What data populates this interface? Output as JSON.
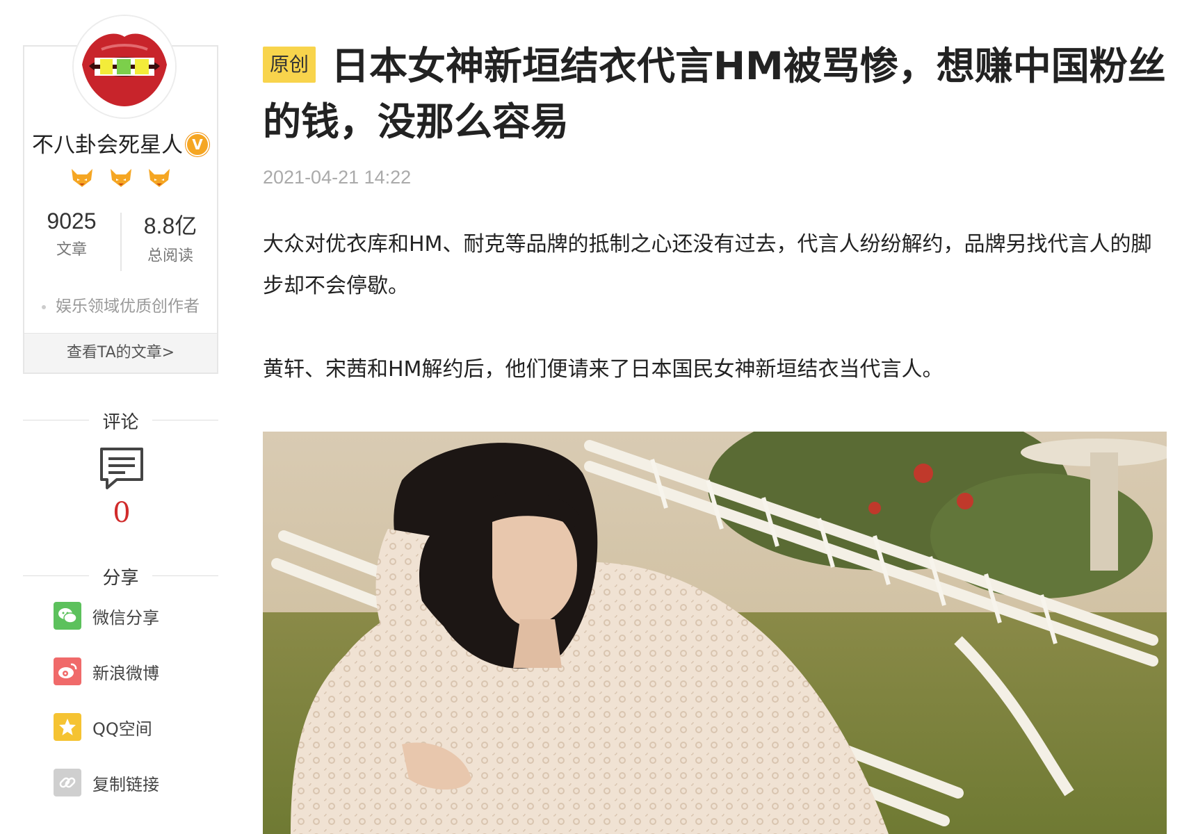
{
  "author": {
    "name": "不八卦会死星人",
    "verified_icon": "verified-v-icon",
    "levels": [
      "fox-level-icon",
      "fox-level-icon",
      "fox-level-icon"
    ],
    "stats": [
      {
        "value": "9025",
        "label": "文章"
      },
      {
        "value": "8.8亿",
        "label": "总阅读"
      }
    ],
    "tag": "娱乐领域优质创作者",
    "link_label": "查看TA的文章>"
  },
  "comments": {
    "title": "评论",
    "icon": "comment-icon",
    "count": "0"
  },
  "share": {
    "title": "分享",
    "items": [
      {
        "label": "微信分享",
        "icon": "wechat-icon",
        "color": "#5cc15c"
      },
      {
        "label": "新浪微博",
        "icon": "weibo-icon",
        "color": "#f06a6a"
      },
      {
        "label": "QQ空间",
        "icon": "qzone-icon",
        "color": "#f5c332"
      },
      {
        "label": "复制链接",
        "icon": "link-icon",
        "color": "#cfcfcf"
      }
    ]
  },
  "article": {
    "tag": "原创",
    "title": "日本女神新垣结衣代言HM被骂惨，想赚中国粉丝的钱，没那么容易",
    "timestamp": "2021-04-21 14:22",
    "paragraphs": [
      "大众对优衣库和HM、耐克等品牌的抵制之心还没有过去，代言人纷纷解约，品牌另找代言人的脚步却不会停歇。",
      "黄轩、宋茜和HM解约后，他们便请来了日本国民女神新垣结衣当代言人。"
    ]
  },
  "colors": {
    "tag_bg": "#f8d44c",
    "comment_count": "#d12b2b",
    "verified": "#f5a623"
  }
}
